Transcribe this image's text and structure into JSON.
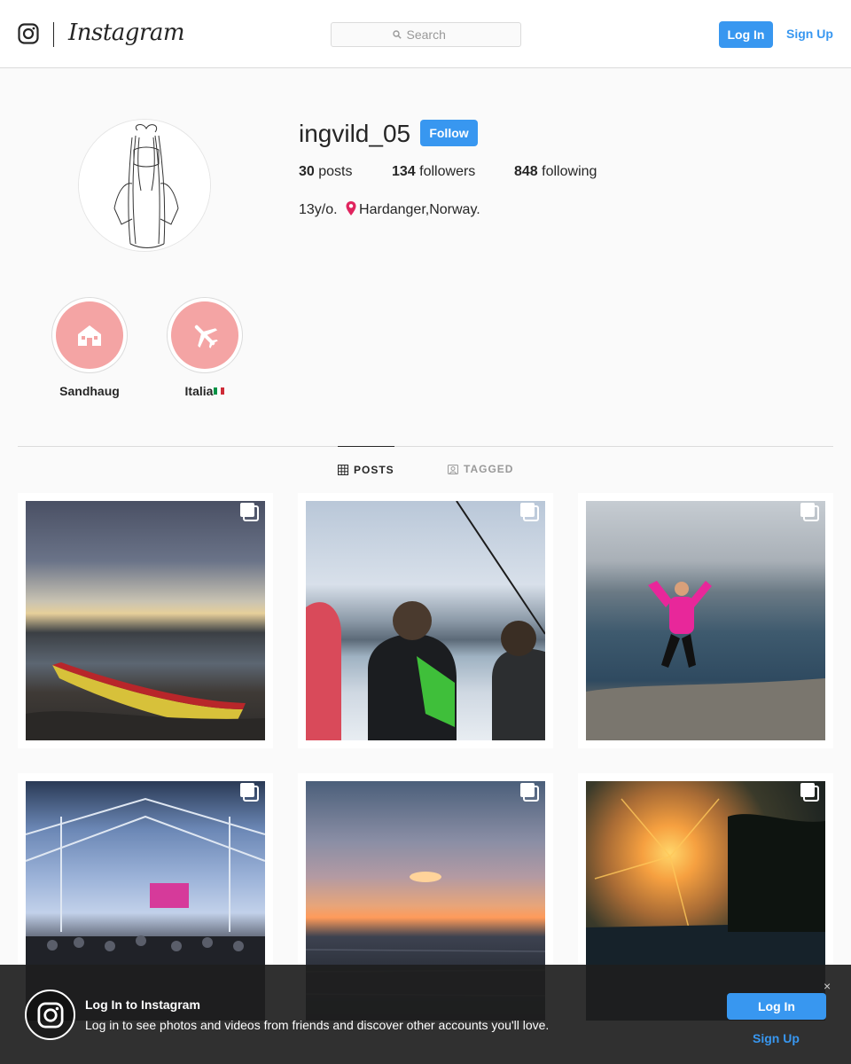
{
  "header": {
    "wordmark": "Instagram",
    "search_placeholder": "Search",
    "login_label": "Log In",
    "signup_label": "Sign Up"
  },
  "profile": {
    "username": "ingvild_05",
    "follow_label": "Follow",
    "posts_count": "30",
    "posts_label": "posts",
    "followers_count": "134",
    "followers_label": "followers",
    "following_count": "848",
    "following_label": "following",
    "bio_prefix": "13y/o.",
    "bio_location": "Hardanger,Norway."
  },
  "highlights": [
    {
      "label": "Sandhaug",
      "icon": "house-icon"
    },
    {
      "label": "Italia",
      "icon": "airplane-icon",
      "flag": "italy"
    }
  ],
  "tabs": [
    {
      "label": "POSTS",
      "active": true,
      "icon": "grid-icon"
    },
    {
      "label": "TAGGED",
      "active": false,
      "icon": "tagged-icon"
    }
  ],
  "posts": [
    {
      "scene": "boat-on-shore-sunset",
      "multi": true
    },
    {
      "scene": "girls-on-ferry-fjord",
      "multi": true
    },
    {
      "scene": "jumping-on-cliff-fjord",
      "multi": true
    },
    {
      "scene": "airport-terminal",
      "multi": true
    },
    {
      "scene": "sunset-over-sea",
      "multi": true
    },
    {
      "scene": "sunset-by-pool",
      "multi": true
    }
  ],
  "banner": {
    "title": "Log In to Instagram",
    "text": "Log in to see photos and videos from friends and discover other accounts you'll love.",
    "login_label": "Log In",
    "signup_label": "Sign Up",
    "close": "×"
  },
  "colors": {
    "accent": "#3897f0",
    "highlight_bg": "#f4a4a4",
    "text": "#262626",
    "muted": "#999999"
  }
}
